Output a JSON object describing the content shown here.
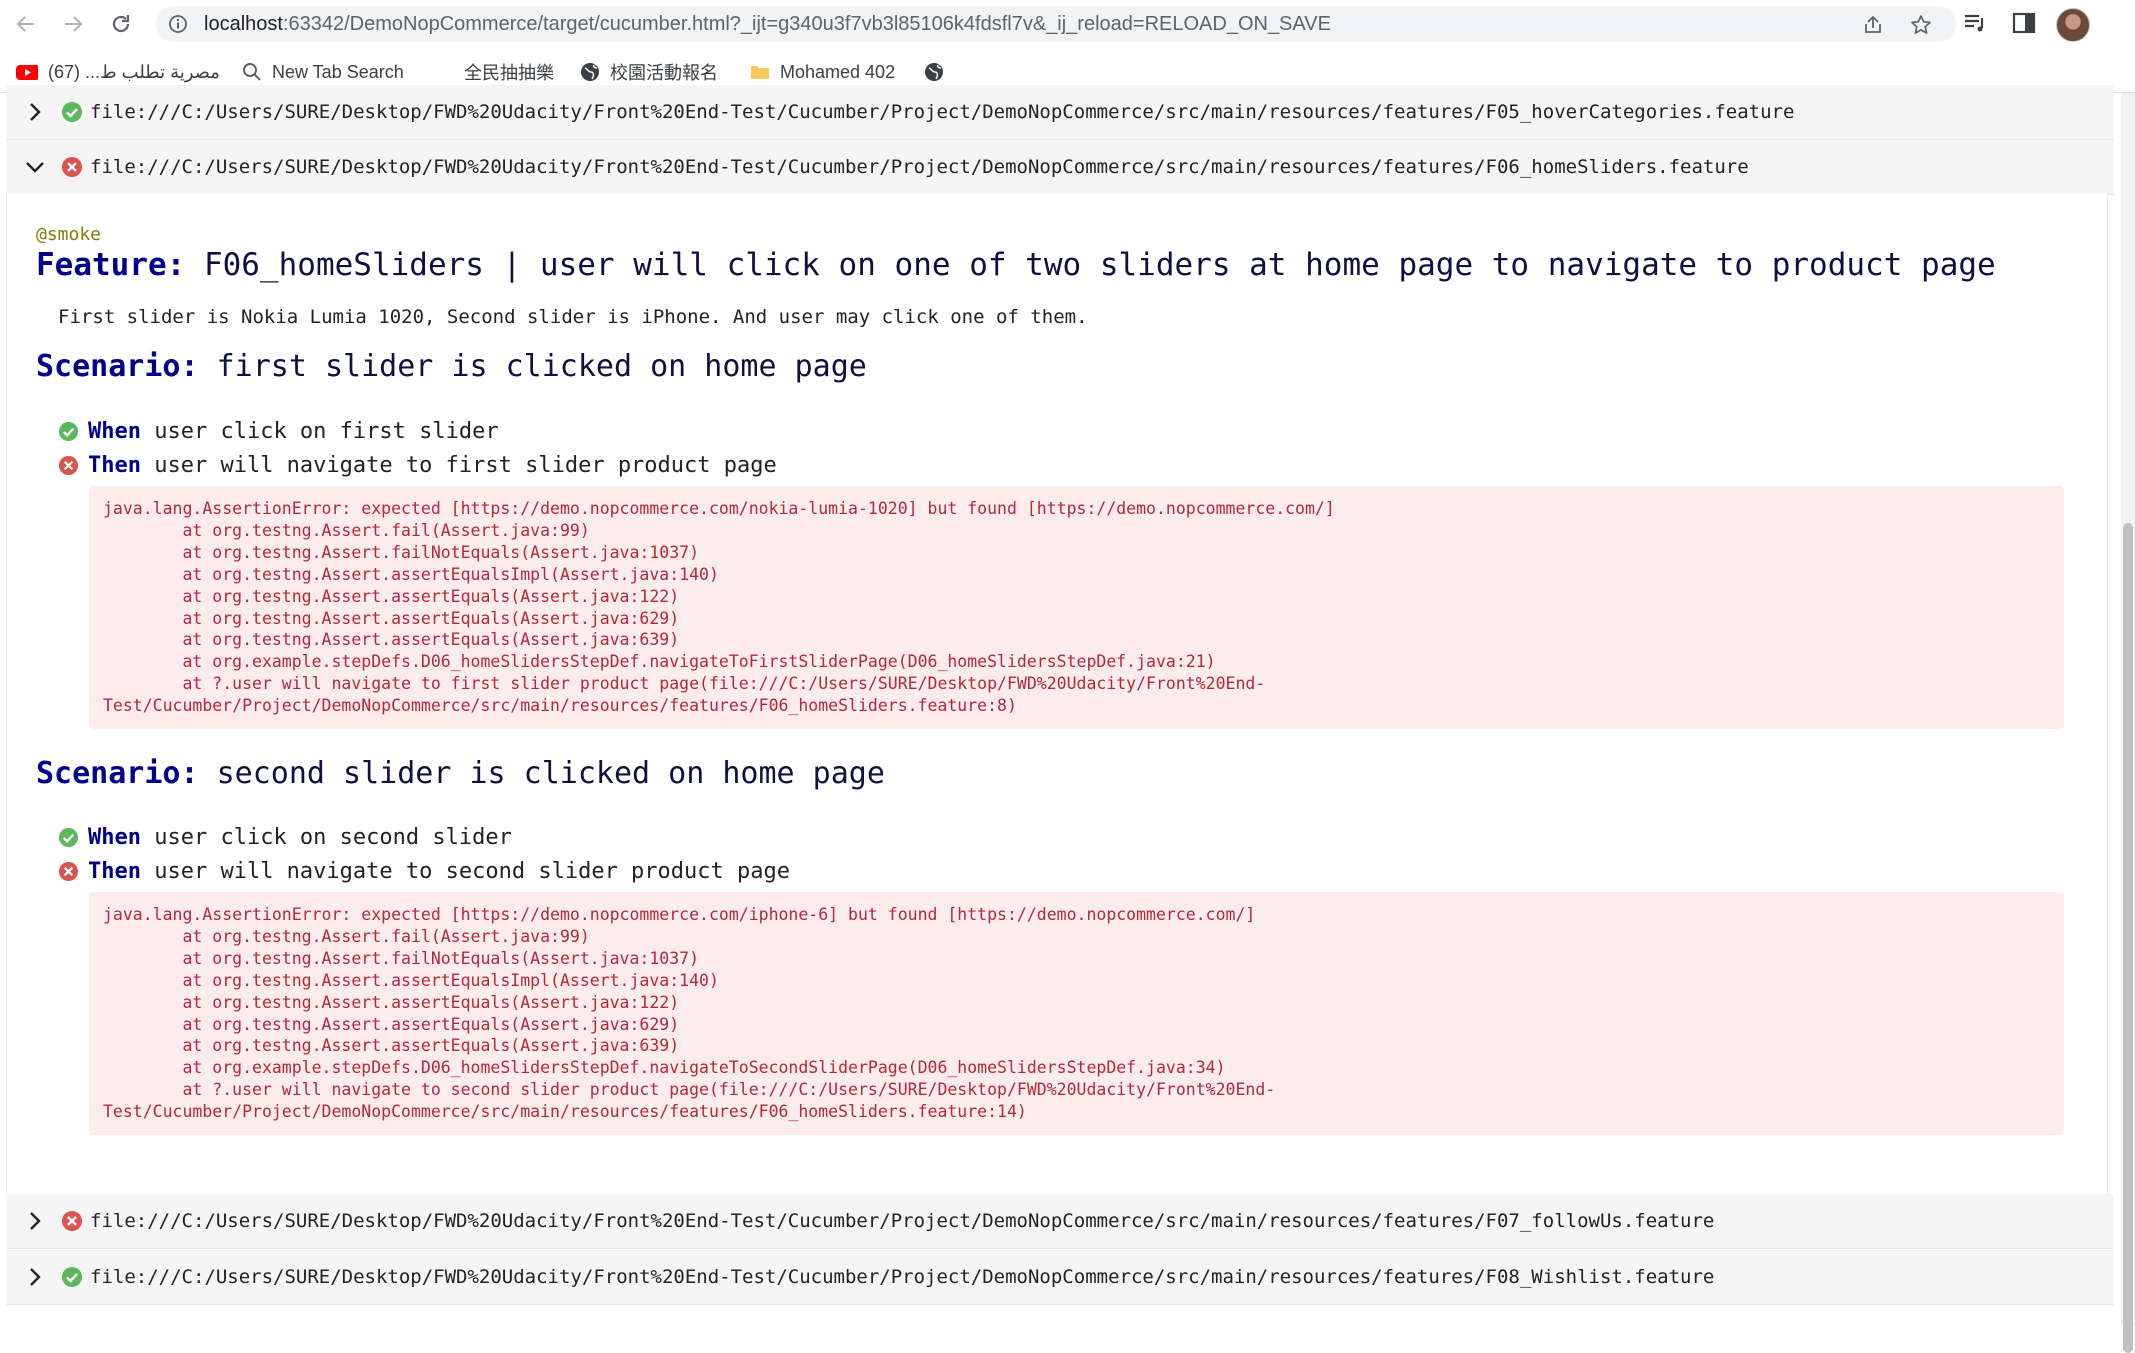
{
  "browser": {
    "url_host": "localhost",
    "url_rest": ":63342/DemoNopCommerce/target/cucumber.html?_ijt=g340u3f7vb3l85106k4fdsfl7v&_ij_reload=RELOAD_ON_SAVE",
    "icons": [
      "back-icon",
      "forward-icon",
      "reload-icon",
      "info-icon",
      "share-icon",
      "star-icon",
      "reading-list-icon",
      "side-panel-icon",
      "profile-avatar"
    ]
  },
  "bookmarks": [
    {
      "label": "مصرية تطلب ط... (67)",
      "icon": "youtube-icon"
    },
    {
      "label": "New Tab Search",
      "icon": "search-icon"
    },
    {
      "label": "全民抽抽樂",
      "icon": "none"
    },
    {
      "label": "校園活動報名",
      "icon": "globe-icon"
    },
    {
      "label": "Mohamed 402",
      "icon": "folder-icon"
    },
    {
      "label": "",
      "icon": "globe-icon"
    }
  ],
  "colors": {
    "passed": "#5cb85c",
    "failed": "#d9534f",
    "keyword": "#00008b",
    "tag": "#8a7a0a",
    "error_bg": "#fdecec",
    "error_text": "#b5283a"
  },
  "features": [
    {
      "path": "file:///C:/Users/SURE/Desktop/FWD%20Udacity/Front%20End-Test/Cucumber/Project/DemoNopCommerce/src/main/resources/features/F05_hoverCategories.feature",
      "status": "passed",
      "expanded": false
    },
    {
      "path": "file:///C:/Users/SURE/Desktop/FWD%20Udacity/Front%20End-Test/Cucumber/Project/DemoNopCommerce/src/main/resources/features/F06_homeSliders.feature",
      "status": "failed",
      "expanded": true
    },
    {
      "path": "file:///C:/Users/SURE/Desktop/FWD%20Udacity/Front%20End-Test/Cucumber/Project/DemoNopCommerce/src/main/resources/features/F07_followUs.feature",
      "status": "failed",
      "expanded": false
    },
    {
      "path": "file:///C:/Users/SURE/Desktop/FWD%20Udacity/Front%20End-Test/Cucumber/Project/DemoNopCommerce/src/main/resources/features/F08_Wishlist.feature",
      "status": "passed",
      "expanded": false
    }
  ],
  "detail": {
    "tag": "@smoke",
    "feature_keyword": "Feature:",
    "feature_name": "F06_homeSliders | user will click on one of two sliders at home page to navigate to product page",
    "description": "First slider is Nokia Lumia 1020, Second slider is iPhone. And user may click one of them.",
    "scenarios": [
      {
        "keyword": "Scenario:",
        "name": "first slider is clicked on home page",
        "steps": [
          {
            "keyword": "When",
            "text": "user click on first slider",
            "status": "passed"
          },
          {
            "keyword": "Then",
            "text": "user will navigate to first slider product page",
            "status": "failed"
          }
        ],
        "error": "java.lang.AssertionError: expected [https://demo.nopcommerce.com/nokia-lumia-1020] but found [https://demo.nopcommerce.com/]\n\tat org.testng.Assert.fail(Assert.java:99)\n\tat org.testng.Assert.failNotEquals(Assert.java:1037)\n\tat org.testng.Assert.assertEqualsImpl(Assert.java:140)\n\tat org.testng.Assert.assertEquals(Assert.java:122)\n\tat org.testng.Assert.assertEquals(Assert.java:629)\n\tat org.testng.Assert.assertEquals(Assert.java:639)\n\tat org.example.stepDefs.D06_homeSlidersStepDef.navigateToFirstSliderPage(D06_homeSlidersStepDef.java:21)\n\tat ?.user will navigate to first slider product page(file:///C:/Users/SURE/Desktop/FWD%20Udacity/Front%20End-\nTest/Cucumber/Project/DemoNopCommerce/src/main/resources/features/F06_homeSliders.feature:8)"
      },
      {
        "keyword": "Scenario:",
        "name": "second slider is clicked on home page",
        "steps": [
          {
            "keyword": "When",
            "text": "user click on second slider",
            "status": "passed"
          },
          {
            "keyword": "Then",
            "text": "user will navigate to second slider product page",
            "status": "failed"
          }
        ],
        "error": "java.lang.AssertionError: expected [https://demo.nopcommerce.com/iphone-6] but found [https://demo.nopcommerce.com/]\n\tat org.testng.Assert.fail(Assert.java:99)\n\tat org.testng.Assert.failNotEquals(Assert.java:1037)\n\tat org.testng.Assert.assertEqualsImpl(Assert.java:140)\n\tat org.testng.Assert.assertEquals(Assert.java:122)\n\tat org.testng.Assert.assertEquals(Assert.java:629)\n\tat org.testng.Assert.assertEquals(Assert.java:639)\n\tat org.example.stepDefs.D06_homeSlidersStepDef.navigateToSecondSliderPage(D06_homeSlidersStepDef.java:34)\n\tat ?.user will navigate to second slider product page(file:///C:/Users/SURE/Desktop/FWD%20Udacity/Front%20End-\nTest/Cucumber/Project/DemoNopCommerce/src/main/resources/features/F06_homeSliders.feature:14)"
      }
    ]
  }
}
